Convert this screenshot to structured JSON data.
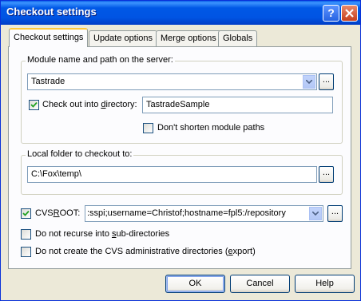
{
  "window": {
    "title": "Checkout settings"
  },
  "tabs": [
    {
      "label": "Checkout settings",
      "active": true
    },
    {
      "label": "Update options",
      "active": false
    },
    {
      "label": "Merge options",
      "active": false
    },
    {
      "label": "Globals",
      "active": false
    }
  ],
  "module_group": {
    "label": "Module name and path on the server:",
    "module_value": "Tastrade",
    "browse_label": "...",
    "checkout_dir_checkbox": {
      "checked": true,
      "label_pre": "Check out into ",
      "label_ul": "d",
      "label_post": "irectory:"
    },
    "checkout_dir_value": "TastradeSample",
    "dont_shorten": {
      "checked": false,
      "label": "Don't shorten module paths"
    }
  },
  "local_group": {
    "label": "Local folder to checkout to:",
    "path_value": "C:\\Fox\\temp\\",
    "browse_label": "..."
  },
  "cvsroot": {
    "checked": true,
    "label_pre": "CVS",
    "label_ul": "R",
    "label_post": "OOT:",
    "value": ":sspi;username=Christof;hostname=fpl5:/repository",
    "browse_label": "..."
  },
  "options": {
    "no_recurse": {
      "checked": false,
      "label_pre": "Do not recurse into ",
      "label_ul": "s",
      "label_post": "ub-directories"
    },
    "no_admin": {
      "checked": false,
      "label_pre": "Do not create the CVS administrative directories (",
      "label_ul": "e",
      "label_post": "xport)"
    }
  },
  "buttons": {
    "ok": "OK",
    "cancel": "Cancel",
    "help": "Help"
  },
  "icons": {
    "help": "question-mark-icon",
    "close": "close-x-icon",
    "dropdown": "chevron-down-icon",
    "check": "checkmark-icon"
  }
}
